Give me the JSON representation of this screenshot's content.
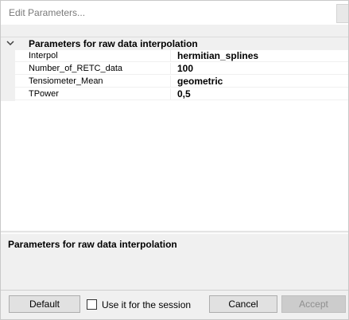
{
  "window": {
    "title": "Edit  Parameters..."
  },
  "grid": {
    "category": {
      "label": "Parameters for raw data interpolation",
      "expanded": true,
      "icon": "chevron-down-icon"
    },
    "properties": [
      {
        "name": "Interpol",
        "value": "hermitian_splines"
      },
      {
        "name": "Number_of_RETC_data",
        "value": "100"
      },
      {
        "name": "Tensiometer_Mean",
        "value": "geometric"
      },
      {
        "name": "TPower",
        "value": "0,5"
      }
    ]
  },
  "help": {
    "title": "Parameters for raw data interpolation"
  },
  "footer": {
    "default_label": "Default",
    "session_checkbox_label": "Use it for the session",
    "session_checked": false,
    "cancel_label": "Cancel",
    "accept_label": "Accept",
    "accept_enabled": false
  }
}
